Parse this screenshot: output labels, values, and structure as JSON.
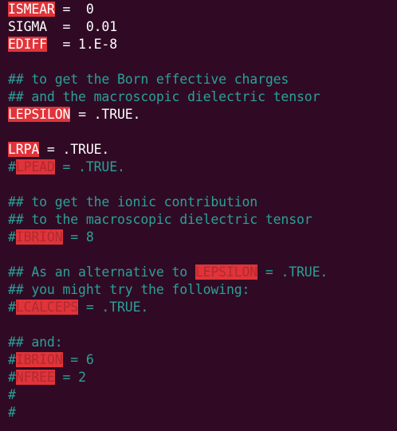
{
  "editor": {
    "colors": {
      "background": "#300a24",
      "text": "#ffffff",
      "comment": "#2aa198",
      "highlight": "#e0343a"
    },
    "lines": [
      {
        "kw": "ISMEAR",
        "rest": " =  0"
      },
      {
        "kw": "SIGMA",
        "rest": "  =  0.01"
      },
      {
        "kw": "EDIFF",
        "rest": "  = 1.E-8"
      },
      {
        "text": ""
      },
      {
        "comment": "## to get the Born effective charges"
      },
      {
        "comment": "## and the macroscopic dielectric tensor"
      },
      {
        "kw": "LEPSILON",
        "rest": " = .TRUE."
      },
      {
        "text": ""
      },
      {
        "kw": "LRPA",
        "rest": " = .TRUE."
      },
      {
        "hash": "#",
        "kw": "LPEAD",
        "rest": " = .TRUE."
      },
      {
        "text": ""
      },
      {
        "comment": "## to get the ionic contribution"
      },
      {
        "comment": "## to the macroscopic dielectric tensor"
      },
      {
        "hash": "#",
        "kw": "IBRION",
        "rest": " = 8"
      },
      {
        "text": ""
      },
      {
        "comment_pre": "## As an alternative to ",
        "kw": "LEPSILON",
        "comment_post": " = .TRUE."
      },
      {
        "comment": "## you might try the following:"
      },
      {
        "hash": "#",
        "kw": "LCALCEPS",
        "rest": " = .TRUE."
      },
      {
        "text": ""
      },
      {
        "comment": "## and:"
      },
      {
        "hash": "#",
        "kw": "IBRION",
        "rest": " = 6"
      },
      {
        "hash": "#",
        "kw": "NFREE",
        "rest": " = 2"
      },
      {
        "comment": "#"
      },
      {
        "comment": "#"
      }
    ]
  }
}
